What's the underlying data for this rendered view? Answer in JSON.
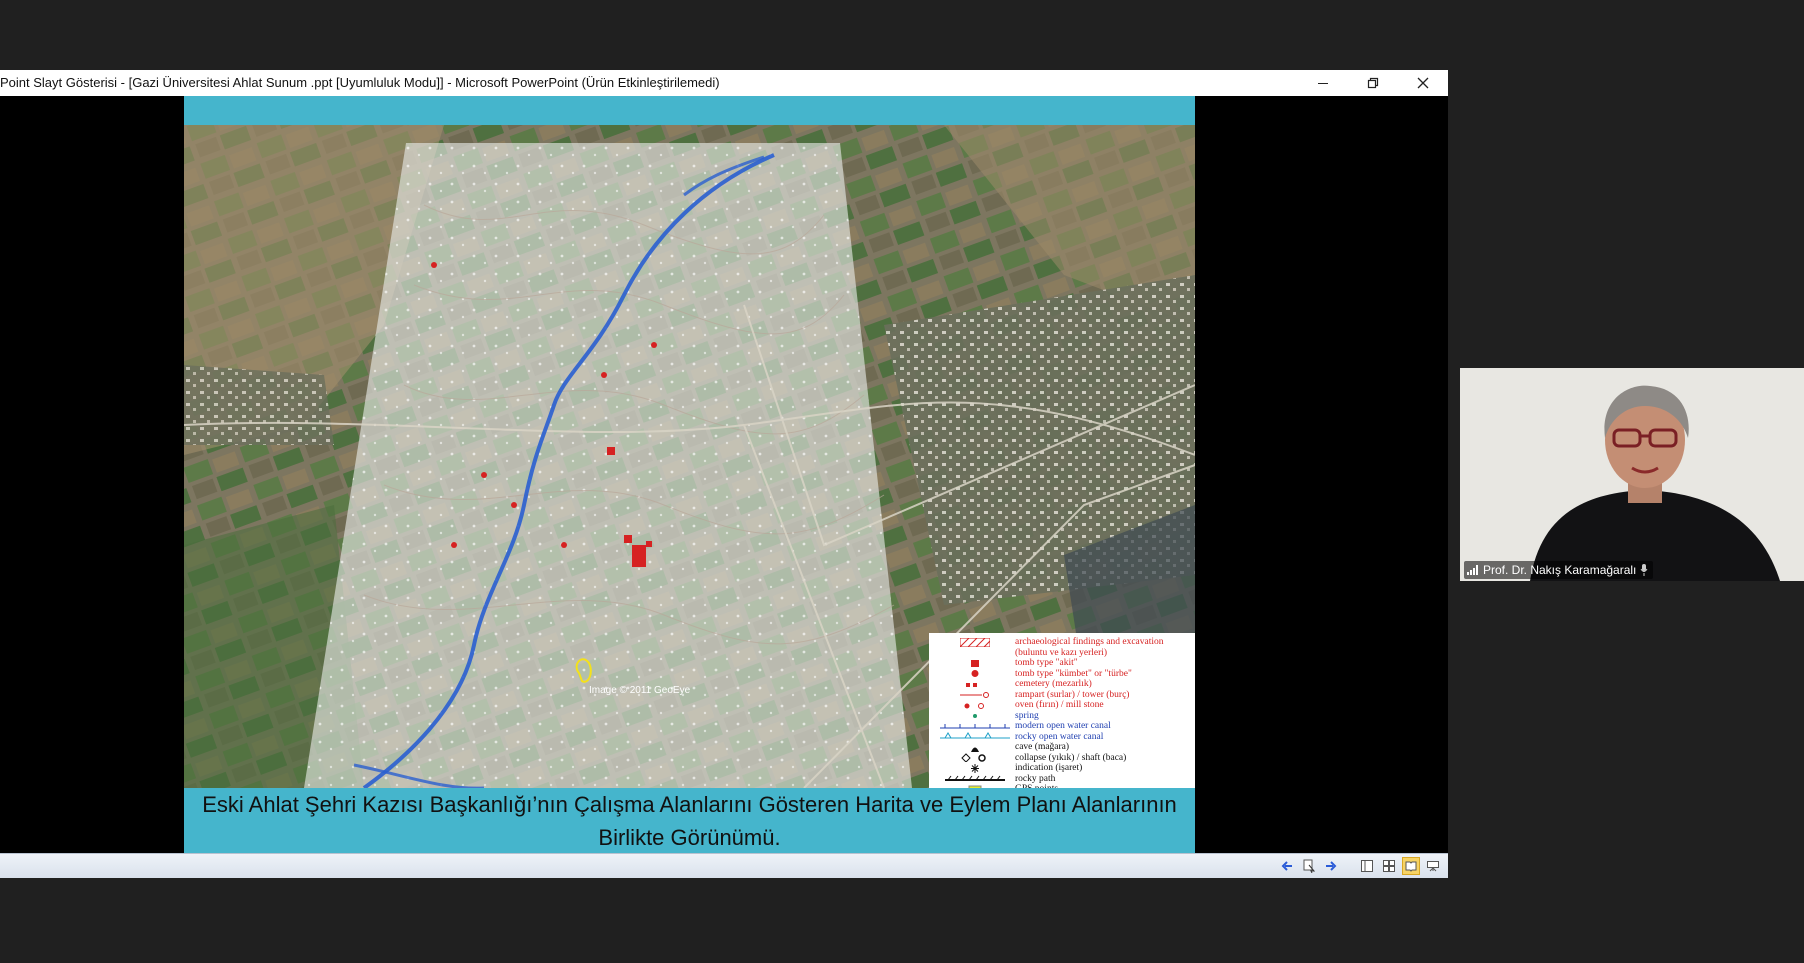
{
  "window": {
    "title": "Point Slayt Gösterisi - [Gazi Üniversitesi Ahlat Sunum .ppt [Uyumluluk Modu]] - Microsoft PowerPoint (Ürün Etkinleştirilemedi)",
    "minimize_icon": "minimize-icon",
    "restore_icon": "restore-icon",
    "close_icon": "close-icon"
  },
  "slide": {
    "caption": "Eski Ahlat Şehri Kazısı Başkanlığı’nın Çalışma Alanlarını Gösteren Harita ve Eylem Planı Alanlarının Birlikte Görünümü.",
    "map_watermark": "Image © 2011 GeoEye",
    "background_color": "#45b5cc",
    "legend": [
      {
        "text": "archaeological findings and excavation",
        "color": "#d62222",
        "symbol": "hatch"
      },
      {
        "text": "(buluntu ve kazı yerleri)",
        "color": "#d62222",
        "symbol": "none"
      },
      {
        "text": "tomb type \"akit\"",
        "color": "#d62222",
        "symbol": "square"
      },
      {
        "text": "tomb type \"kümbet\" or \"türbe\"",
        "color": "#d62222",
        "symbol": "dot"
      },
      {
        "text": "cemetery (mezarlık)",
        "color": "#d62222",
        "symbol": "small"
      },
      {
        "text": "rampart (surlar) / tower (burç)",
        "color": "#d62222",
        "symbol": "tower"
      },
      {
        "text": "oven (fırın) / mill stone",
        "color": "#d62222",
        "symbol": "oven"
      },
      {
        "text": "spring",
        "color": "#1f3fb0",
        "symbol": "spring"
      },
      {
        "text": "modern open water canal",
        "color": "#1f3fb0",
        "symbol": "canal"
      },
      {
        "text": "rocky open water canal",
        "color": "#1f3fb0",
        "symbol": "rocky"
      },
      {
        "text": "cave (mağara)",
        "color": "#111111",
        "symbol": "cave"
      },
      {
        "text": "collapse (yıkık) / shaft (baca)",
        "color": "#111111",
        "symbol": "collapse"
      },
      {
        "text": "indication (işaret)",
        "color": "#111111",
        "symbol": "star"
      },
      {
        "text": "rocky path",
        "color": "#111111",
        "symbol": "path"
      },
      {
        "text": "GPS points",
        "color": "#111111",
        "symbol": "gps"
      }
    ]
  },
  "statusbar": {
    "buttons": [
      "previous-slide-icon",
      "menu-icon",
      "next-slide-icon",
      "normal-view-icon",
      "slide-sorter-icon",
      "reading-view-icon",
      "slideshow-icon"
    ]
  },
  "video": {
    "participant_name": "Prof. Dr. Nakış Karamağaralı",
    "signal_icon": "signal-bars-icon",
    "mic_icon": "microphone-icon"
  }
}
